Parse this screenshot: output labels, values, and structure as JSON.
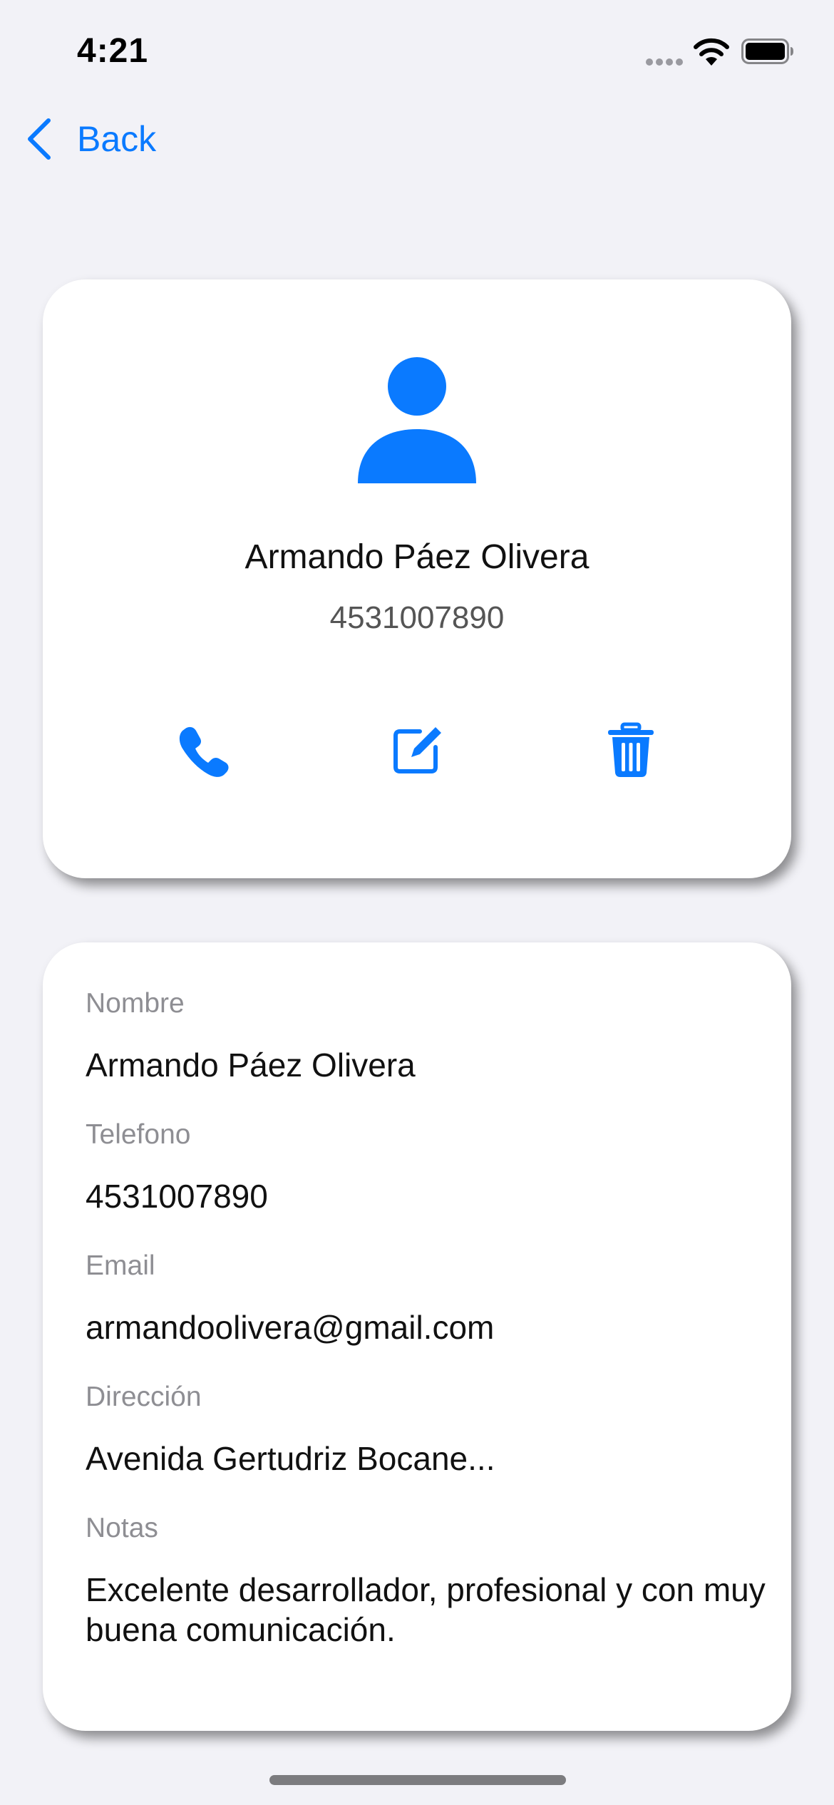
{
  "status_bar": {
    "time": "4:21"
  },
  "nav": {
    "back_label": "Back"
  },
  "header_card": {
    "name": "Armando Páez Olivera",
    "phone": "4531007890",
    "actions": [
      "phone-icon",
      "compose-icon",
      "trash-icon"
    ]
  },
  "details": {
    "fields": [
      {
        "label": "Nombre",
        "value": "Armando Páez Olivera"
      },
      {
        "label": "Telefono",
        "value": "4531007890"
      },
      {
        "label": "Email",
        "value": "armandoolivera@gmail.com"
      },
      {
        "label": "Dirección",
        "value": "Avenida Gertudriz Bocane..."
      },
      {
        "label": "Notas",
        "value": "Excelente desarrollador, profesional y con muy buena comunicación."
      }
    ]
  },
  "colors": {
    "accent": "#0a7aff",
    "background": "#f2f2f7",
    "card": "#ffffff",
    "secondary_text": "#8e8e93"
  }
}
